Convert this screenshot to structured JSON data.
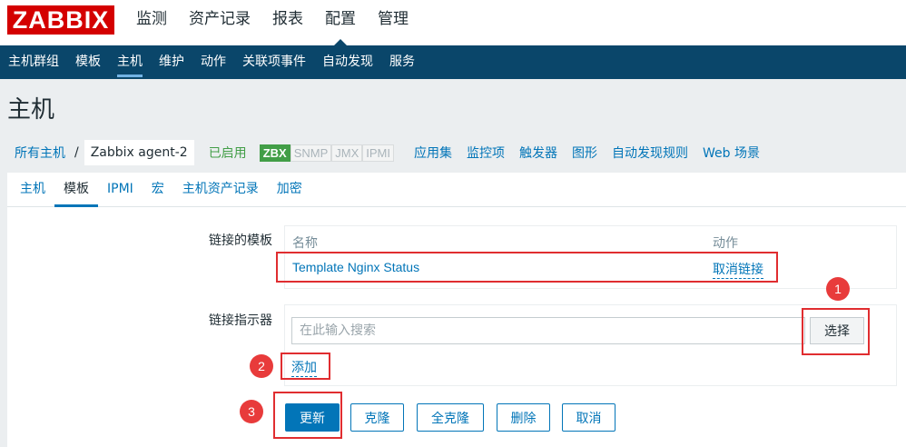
{
  "brand": "ZABBIX",
  "top_nav": [
    "监测",
    "资产记录",
    "报表",
    "配置",
    "管理"
  ],
  "sub_nav": [
    "主机群组",
    "模板",
    "主机",
    "维护",
    "动作",
    "关联项事件",
    "自动发现",
    "服务"
  ],
  "page_title": "主机",
  "breadcrumb": {
    "all_hosts": "所有主机",
    "separator": "/",
    "current_host": "Zabbix agent-2",
    "status": "已启用",
    "availability": [
      "ZBX",
      "SNMP",
      "JMX",
      "IPMI"
    ],
    "links": [
      "应用集",
      "监控项",
      "触发器",
      "图形",
      "自动发现规则",
      "Web 场景"
    ]
  },
  "tabs": [
    "主机",
    "模板",
    "IPMI",
    "宏",
    "主机资产记录",
    "加密"
  ],
  "form": {
    "linked_templates_label": "链接的模板",
    "col_name": "名称",
    "col_action": "动作",
    "template_name": "Template Nginx Status",
    "unlink_label": "取消链接",
    "link_new_label": "链接指示器",
    "search_placeholder": "在此输入搜索",
    "select_label": "选择",
    "add_label": "添加"
  },
  "buttons": {
    "update": "更新",
    "clone": "克隆",
    "full_clone": "全克隆",
    "delete": "删除",
    "cancel": "取消"
  },
  "annotations": [
    "1",
    "2",
    "3"
  ],
  "colors": {
    "brand_red": "#d40000",
    "nav_blue": "#0a466a",
    "link_blue": "#0275b8",
    "enabled_green": "#429e47",
    "highlight_red": "#e02d30"
  }
}
